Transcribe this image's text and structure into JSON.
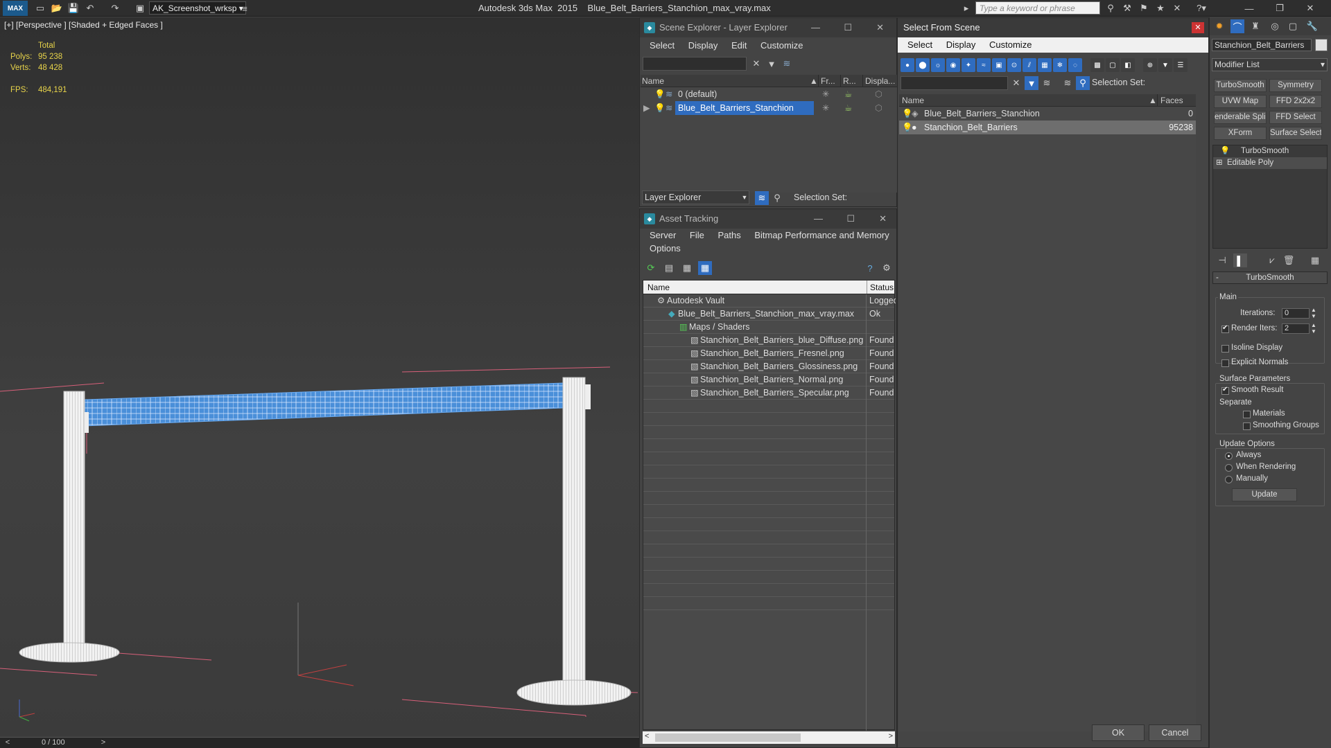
{
  "titlebar": {
    "workspace": "AK_Screenshot_wrksp",
    "app_name": "Autodesk 3ds Max  2015",
    "file_name": "Blue_Belt_Barriers_Stanchion_max_vray.max",
    "search_placeholder": "Type a keyword or phrase"
  },
  "viewport": {
    "label": "[+] [Perspective ] [Shaded + Edged Faces ]",
    "stats": {
      "total_label": "Total",
      "polys_label": "Polys:",
      "polys_value": "95 238",
      "verts_label": "Verts:",
      "verts_value": "48 428",
      "fps_label": "FPS:",
      "fps_value": "484,191"
    },
    "timeline": "0 / 100",
    "accent": "#4a8fd9"
  },
  "scene_explorer": {
    "title": "Scene Explorer - Layer Explorer",
    "menu": [
      "Select",
      "Display",
      "Edit",
      "Customize"
    ],
    "columns": {
      "name": "Name",
      "frozen": "Fr...",
      "render": "R...",
      "display": "Displa..."
    },
    "rows": [
      {
        "name": "0 (default)",
        "selected": false
      },
      {
        "name": "Blue_Belt_Barriers_Stanchion",
        "selected": true
      }
    ],
    "footer_dropdown": "Layer Explorer",
    "selection_set_label": "Selection Set:"
  },
  "asset_tracking": {
    "title": "Asset Tracking",
    "menu": [
      "Server",
      "File",
      "Paths",
      "Bitmap Performance and Memory"
    ],
    "menu2": [
      "Options"
    ],
    "columns": {
      "name": "Name",
      "status": "Status"
    },
    "rows": [
      {
        "name": "Autodesk Vault",
        "status": "Logged",
        "indent": 0
      },
      {
        "name": "Blue_Belt_Barriers_Stanchion_max_vray.max",
        "status": "Ok",
        "indent": 1
      },
      {
        "name": "Maps / Shaders",
        "status": "",
        "indent": 2
      },
      {
        "name": "Stanchion_Belt_Barriers_blue_Diffuse.png",
        "status": "Found",
        "indent": 3
      },
      {
        "name": "Stanchion_Belt_Barriers_Fresnel.png",
        "status": "Found",
        "indent": 3
      },
      {
        "name": "Stanchion_Belt_Barriers_Glossiness.png",
        "status": "Found",
        "indent": 3
      },
      {
        "name": "Stanchion_Belt_Barriers_Normal.png",
        "status": "Found",
        "indent": 3
      },
      {
        "name": "Stanchion_Belt_Barriers_Specular.png",
        "status": "Found",
        "indent": 3
      }
    ]
  },
  "select_from_scene": {
    "title": "Select From Scene",
    "menu": [
      "Select",
      "Display",
      "Customize"
    ],
    "selection_set_label": "Selection Set:",
    "columns": {
      "name": "Name",
      "faces": "Faces"
    },
    "rows": [
      {
        "name": "Blue_Belt_Barriers_Stanchion",
        "faces": "0",
        "selected": false
      },
      {
        "name": "Stanchion_Belt_Barriers",
        "faces": "95238",
        "selected": true
      }
    ],
    "ok_label": "OK",
    "cancel_label": "Cancel"
  },
  "command_panel": {
    "object_name": "Stanchion_Belt_Barriers",
    "modifier_list": "Modifier List",
    "buttons": [
      "TurboSmooth",
      "Symmetry",
      "UVW Map",
      "FFD 2x2x2",
      "enderable Splir",
      "FFD Select",
      "XForm",
      "Surface Select"
    ],
    "stack": [
      "TurboSmooth",
      "Editable Poly"
    ],
    "rollout_title": "TurboSmooth",
    "main_label": "Main",
    "iterations_label": "Iterations:",
    "iterations_value": "0",
    "render_iters_label": "Render Iters:",
    "render_iters_value": "2",
    "isoline_label": "Isoline Display",
    "explicit_normals_label": "Explicit Normals",
    "surface_params_label": "Surface Parameters",
    "smooth_result_label": "Smooth Result",
    "separate_label": "Separate",
    "materials_label": "Materials",
    "smoothing_groups_label": "Smoothing Groups",
    "update_options_label": "Update Options",
    "always_label": "Always",
    "when_rendering_label": "When Rendering",
    "manually_label": "Manually",
    "update_label": "Update"
  }
}
